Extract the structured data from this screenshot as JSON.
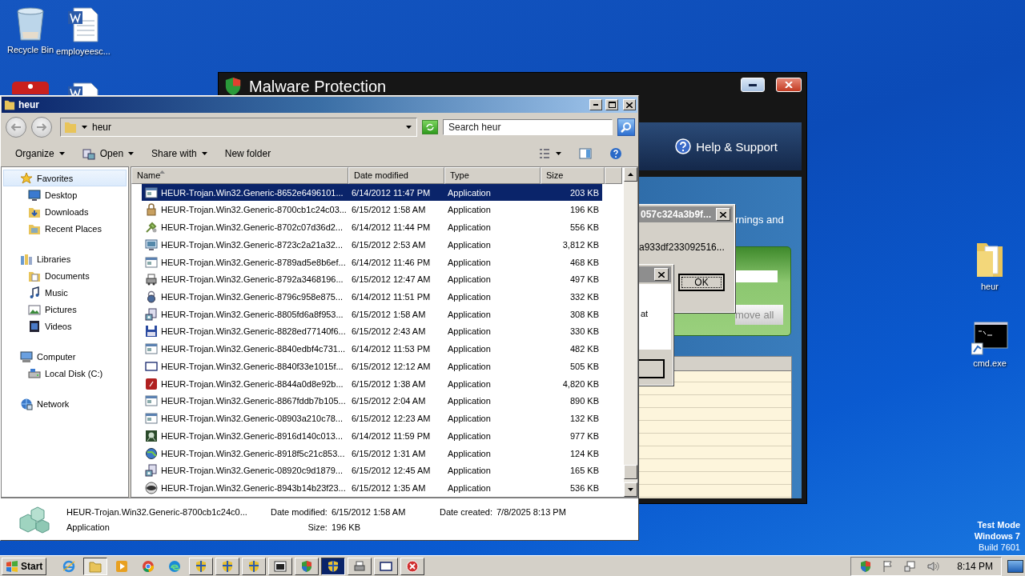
{
  "desktop": {
    "icons": [
      {
        "label": "Recycle Bin",
        "kind": "recycle"
      },
      {
        "label": "employeesc...",
        "kind": "word"
      },
      {
        "kind": "red-app"
      },
      {
        "kind": "word"
      },
      {
        "label": "heur",
        "kind": "folder"
      },
      {
        "label": "cmd.exe",
        "kind": "console"
      }
    ],
    "edition": [
      "Test Mode",
      "Windows 7",
      "Build 7601"
    ]
  },
  "malware_window": {
    "title": "Malware Protection",
    "help_link": "Help & Support",
    "text_fragment": "rnings and",
    "button": "move all"
  },
  "dialogs": [
    {
      "title": "057c324a3b9f...",
      "text": "a933df233092516...",
      "button": "OK"
    },
    {
      "text": "at"
    }
  ],
  "explorer": {
    "title": "heur",
    "address": "heur",
    "search": {
      "placeholder": "Search heur"
    },
    "toolbar": [
      {
        "label": "Organize",
        "kind": "plain",
        "dropdown": true
      },
      {
        "label": "Open",
        "kind": "open",
        "dropdown": true
      },
      {
        "label": "Share with",
        "kind": "plain",
        "dropdown": true
      },
      {
        "label": "New folder",
        "kind": "plain",
        "dropdown": false
      }
    ],
    "navigation": [
      {
        "label": "Favorites",
        "kind": "star",
        "selected": true,
        "children": [
          {
            "label": "Desktop",
            "kind": "desktop",
            "selected": false
          },
          {
            "label": "Downloads",
            "kind": "downloads",
            "selected": false
          },
          {
            "label": "Recent Places",
            "kind": "recent",
            "selected": false
          }
        ]
      },
      {
        "label": "Libraries",
        "kind": "library",
        "selected": false,
        "children": [
          {
            "label": "Documents",
            "kind": "documents",
            "selected": false
          },
          {
            "label": "Music",
            "kind": "music",
            "selected": false
          },
          {
            "label": "Pictures",
            "kind": "pictures",
            "selected": false
          },
          {
            "label": "Videos",
            "kind": "videos",
            "selected": false
          }
        ]
      },
      {
        "label": "Computer",
        "kind": "computer",
        "selected": false,
        "children": [
          {
            "label": "Local Disk (C:)",
            "kind": "disk",
            "selected": false
          }
        ]
      },
      {
        "label": "Network",
        "kind": "network",
        "selected": false
      }
    ],
    "columns": [
      {
        "label": "Name",
        "sorted": true
      },
      {
        "label": "Date modified",
        "sorted": false
      },
      {
        "label": "Type",
        "sorted": false
      },
      {
        "label": "Size",
        "sorted": false
      }
    ],
    "rows": [
      {
        "name": "HEUR-Trojan.Win32.Generic-8652e6496101...",
        "date": "6/14/2012 11:47 PM",
        "type": "Application",
        "size": "203 KB",
        "kind": "app",
        "selected": true
      },
      {
        "name": "HEUR-Trojan.Win32.Generic-8700cb1c24c03...",
        "date": "6/15/2012 1:58 AM",
        "type": "Application",
        "size": "196 KB",
        "kind": "lock",
        "selected": false
      },
      {
        "name": "HEUR-Trojan.Win32.Generic-8702c07d36d2...",
        "date": "6/14/2012 11:44 PM",
        "type": "Application",
        "size": "556 KB",
        "kind": "tools",
        "selected": false
      },
      {
        "name": "HEUR-Trojan.Win32.Generic-8723c2a21a32...",
        "date": "6/15/2012 2:53 AM",
        "type": "Application",
        "size": "3,812 KB",
        "kind": "screen",
        "selected": false
      },
      {
        "name": "HEUR-Trojan.Win32.Generic-8789ad5e8b6ef...",
        "date": "6/14/2012 11:46 PM",
        "type": "Application",
        "size": "468 KB",
        "kind": "app",
        "selected": false
      },
      {
        "name": "HEUR-Trojan.Win32.Generic-8792a3468196...",
        "date": "6/15/2012 12:47 AM",
        "type": "Application",
        "size": "497 KB",
        "kind": "printer",
        "selected": false
      },
      {
        "name": "HEUR-Trojan.Win32.Generic-8796c958e875...",
        "date": "6/14/2012 11:51 PM",
        "type": "Application",
        "size": "332 KB",
        "kind": "padlock",
        "selected": false
      },
      {
        "name": "HEUR-Trojan.Win32.Generic-8805fd6a8f953...",
        "date": "6/15/2012 1:58 AM",
        "type": "Application",
        "size": "308 KB",
        "kind": "installer",
        "selected": false
      },
      {
        "name": "HEUR-Trojan.Win32.Generic-8828ed77140f6...",
        "date": "6/15/2012 2:43 AM",
        "type": "Application",
        "size": "330 KB",
        "kind": "floppy",
        "selected": false
      },
      {
        "name": "HEUR-Trojan.Win32.Generic-8840edbf4c731...",
        "date": "6/14/2012 11:53 PM",
        "type": "Application",
        "size": "482 KB",
        "kind": "app",
        "selected": false
      },
      {
        "name": "HEUR-Trojan.Win32.Generic-8840f33e1015f...",
        "date": "6/15/2012 12:12 AM",
        "type": "Application",
        "size": "505 KB",
        "kind": "frame",
        "selected": false
      },
      {
        "name": "HEUR-Trojan.Win32.Generic-8844a0d8e92b...",
        "date": "6/15/2012 1:38 AM",
        "type": "Application",
        "size": "4,820 KB",
        "kind": "red",
        "selected": false
      },
      {
        "name": "HEUR-Trojan.Win32.Generic-8867fddb7b105...",
        "date": "6/15/2012 2:04 AM",
        "type": "Application",
        "size": "890 KB",
        "kind": "app",
        "selected": false
      },
      {
        "name": "HEUR-Trojan.Win32.Generic-08903a210c78...",
        "date": "6/15/2012 12:23 AM",
        "type": "Application",
        "size": "132 KB",
        "kind": "app",
        "selected": false
      },
      {
        "name": "HEUR-Trojan.Win32.Generic-8916d140c013...",
        "date": "6/14/2012 11:59 PM",
        "type": "Application",
        "size": "977 KB",
        "kind": "game",
        "selected": false
      },
      {
        "name": "HEUR-Trojan.Win32.Generic-8918f5c21c853...",
        "date": "6/15/2012 1:31 AM",
        "type": "Application",
        "size": "124 KB",
        "kind": "globe",
        "selected": false
      },
      {
        "name": "HEUR-Trojan.Win32.Generic-08920c9d1879...",
        "date": "6/15/2012 12:45 AM",
        "type": "Application",
        "size": "165 KB",
        "kind": "installer",
        "selected": false
      },
      {
        "name": "HEUR-Trojan.Win32.Generic-8943b14b23f23...",
        "date": "6/15/2012 1:35 AM",
        "type": "Application",
        "size": "536 KB",
        "kind": "dvd",
        "selected": false
      }
    ],
    "details": {
      "name": "HEUR-Trojan.Win32.Generic-8700cb1c24c0...",
      "type": "Application",
      "modified_label": "Date modified:",
      "modified": "6/15/2012 1:58 AM",
      "size_label": "Size:",
      "size": "196 KB",
      "created_label": "Date created:",
      "created": "7/8/2025 8:13 PM"
    }
  },
  "taskbar": {
    "start": "Start",
    "items": [
      {
        "kind": "ie",
        "selected": false
      },
      {
        "kind": "explorer",
        "selected": true
      },
      {
        "kind": "media",
        "selected": false
      },
      {
        "kind": "chrome",
        "selected": false
      },
      {
        "kind": "edge",
        "selected": false
      },
      {
        "kind": "shield",
        "selected": false
      },
      {
        "kind": "shield",
        "selected": false
      },
      {
        "kind": "shield",
        "selected": false
      },
      {
        "kind": "console",
        "selected": false
      },
      {
        "kind": "color-shield",
        "selected": false
      },
      {
        "kind": "shield",
        "selected": true
      },
      {
        "kind": "printer",
        "selected": false
      },
      {
        "kind": "window",
        "selected": false
      },
      {
        "kind": "error",
        "selected": false
      }
    ],
    "clock": "8:14 PM"
  }
}
